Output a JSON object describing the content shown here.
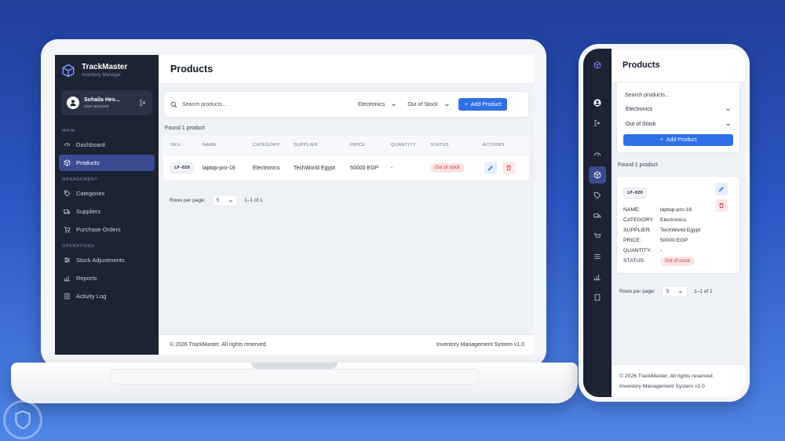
{
  "app": {
    "name": "TrackMaster",
    "subtitle": "Inventory Manager"
  },
  "user": {
    "name": "Sohaila Hes...",
    "role": "user account"
  },
  "sidebar": {
    "sections": [
      {
        "label": "MAIN",
        "items": [
          {
            "label": "Dashboard",
            "icon": "gauge-icon"
          },
          {
            "label": "Products",
            "icon": "box-icon",
            "active": true
          }
        ]
      },
      {
        "label": "MANAGEMENT",
        "items": [
          {
            "label": "Categories",
            "icon": "tag-icon"
          },
          {
            "label": "Suppliers",
            "icon": "truck-icon"
          },
          {
            "label": "Purchase Orders",
            "icon": "cart-icon"
          }
        ]
      },
      {
        "label": "OPERATIONS",
        "items": [
          {
            "label": "Stock Adjustments",
            "icon": "sliders-icon"
          },
          {
            "label": "Reports",
            "icon": "bar-chart-icon"
          },
          {
            "label": "Activity Log",
            "icon": "clipboard-icon"
          }
        ]
      }
    ]
  },
  "page": {
    "title": "Products"
  },
  "filters": {
    "search_placeholder": "Search products...",
    "category": "Electronics",
    "stock": "Out of Stock",
    "add_label": "Add Product"
  },
  "results": {
    "found": "Found 1 product"
  },
  "table": {
    "headers": [
      "SKU",
      "NAME",
      "CATEGORY",
      "SUPPLIER",
      "PRICE",
      "QUANTITY",
      "STATUS",
      "ACTIONS"
    ],
    "rows": [
      {
        "sku": "LP-020",
        "name": "laptop-pro-16",
        "category": "Electronics",
        "supplier": "TechWorld Egypt",
        "price": "50000 EGP",
        "quantity": "-",
        "status": "Out of stock"
      }
    ]
  },
  "pagination": {
    "rows_label": "Rows per page:",
    "rows_value": "5",
    "range": "1–1 of 1"
  },
  "footer": {
    "copyright": "© 2026 TrackMaster. All rights reserved.",
    "version": "Inventory Management System v1.0"
  },
  "mobile": {
    "card_labels": {
      "name": "NAME:",
      "category": "CATEGORY:",
      "supplier": "SUPPLIER:",
      "price": "PRICE:",
      "quantity": "QUANTITY:",
      "status": "STATUS:"
    }
  },
  "colors": {
    "accent": "#2f6fe8",
    "sidebar": "#1c2333",
    "active": "#3c4a90",
    "danger": "#d1383d",
    "background": "#2c56c4"
  }
}
